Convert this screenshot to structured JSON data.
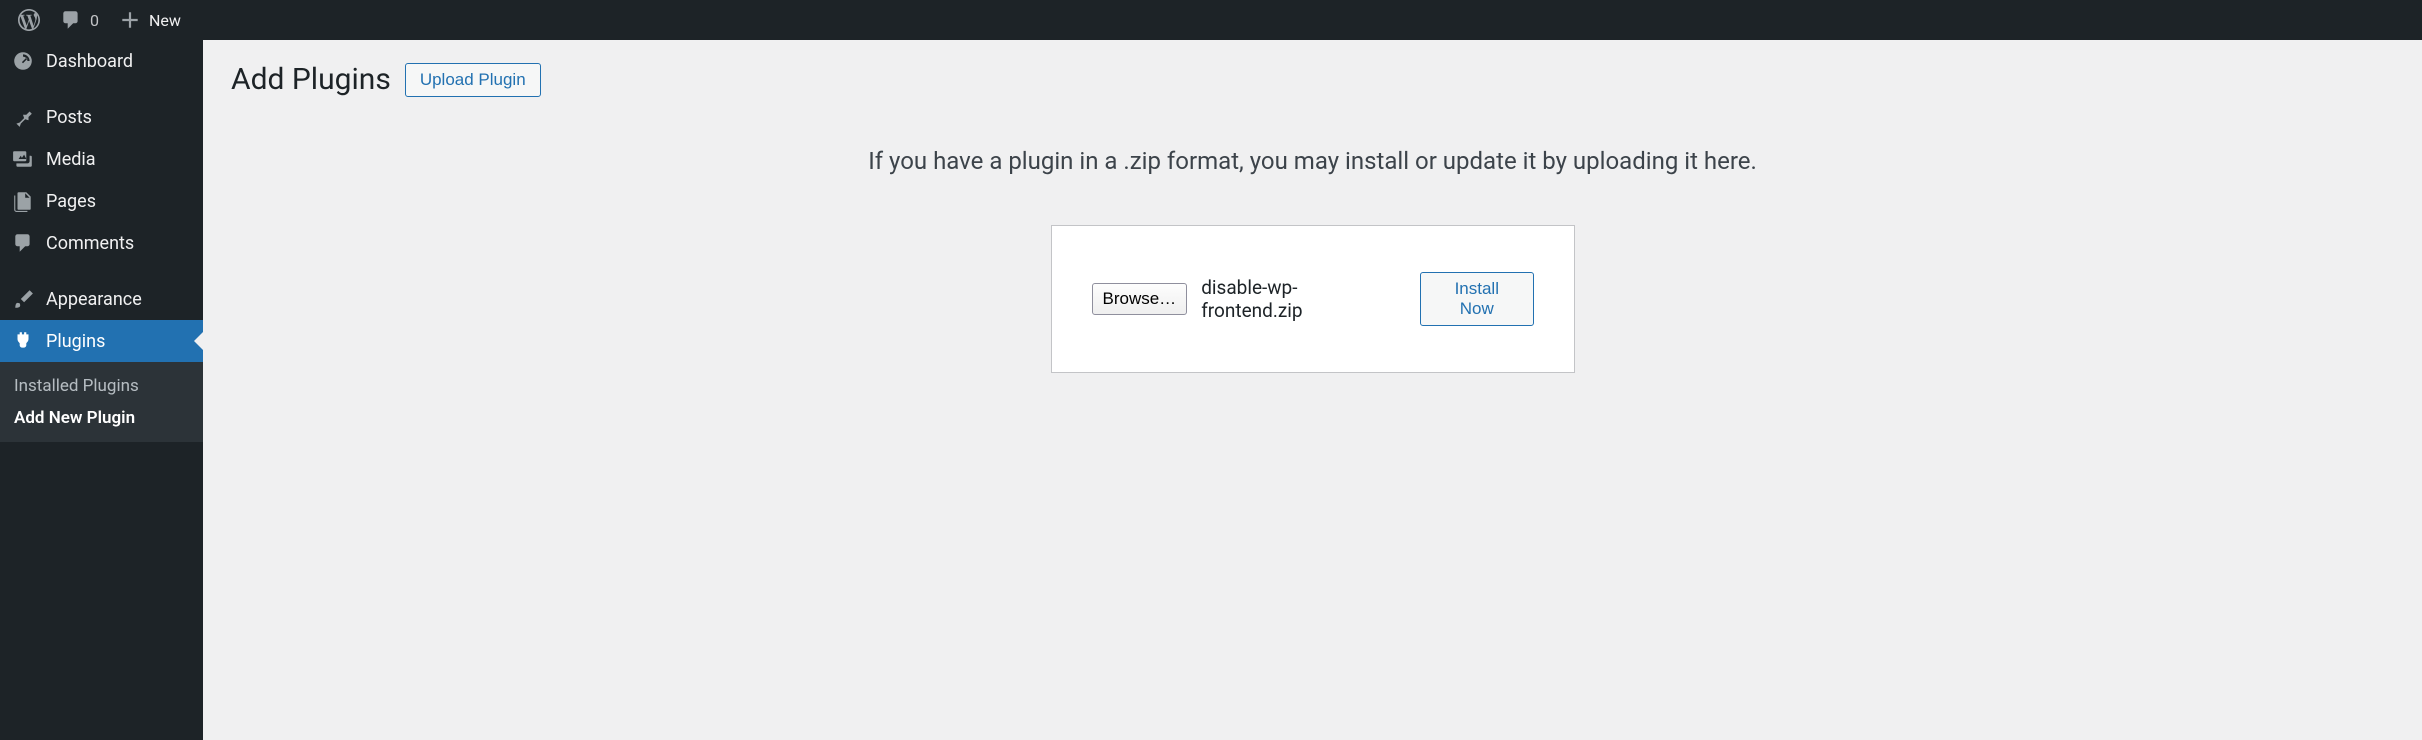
{
  "adminbar": {
    "comment_count": "0",
    "new_label": "New"
  },
  "sidebar": {
    "items": [
      {
        "label": "Dashboard"
      },
      {
        "label": "Posts"
      },
      {
        "label": "Media"
      },
      {
        "label": "Pages"
      },
      {
        "label": "Comments"
      },
      {
        "label": "Appearance"
      },
      {
        "label": "Plugins"
      }
    ],
    "submenu": {
      "installed": "Installed Plugins",
      "addnew": "Add New Plugin"
    }
  },
  "header": {
    "title": "Add Plugins",
    "upload_button": "Upload Plugin"
  },
  "upload": {
    "help_text": "If you have a plugin in a .zip format, you may install or update it by uploading it here.",
    "browse_label": "Browse…",
    "selected_file": "disable-wp-frontend.zip",
    "install_label": "Install Now"
  }
}
